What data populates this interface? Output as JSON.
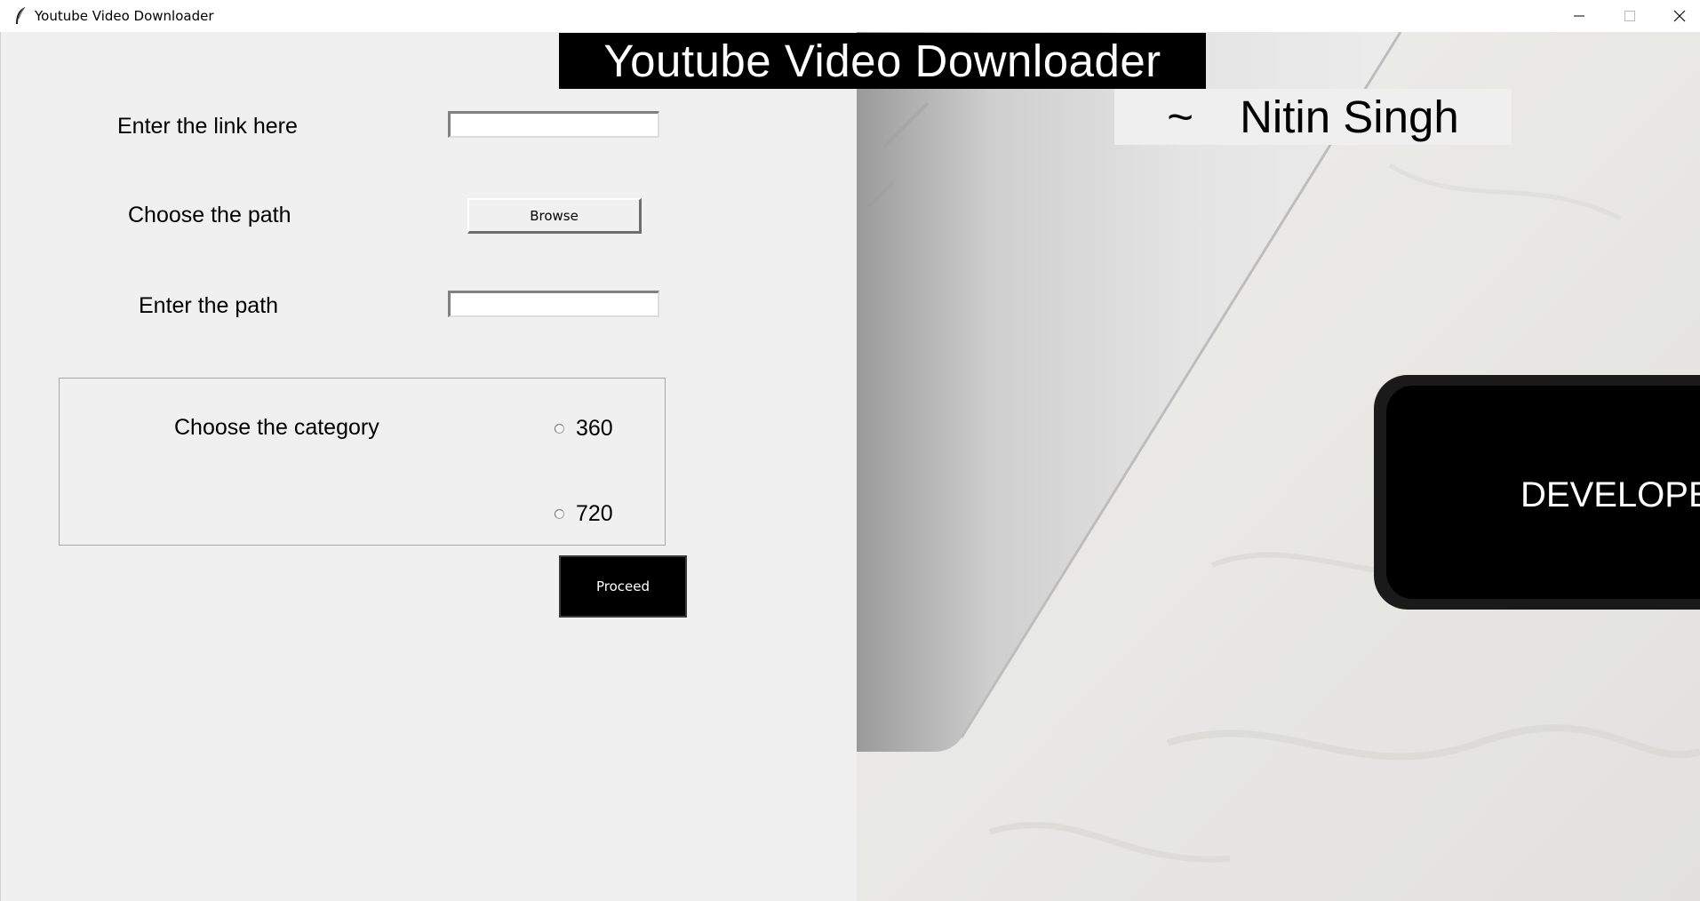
{
  "window": {
    "title": "Youtube Video Downloader",
    "controls": {
      "minimize_icon": "minimize-icon",
      "maximize_icon": "maximize-icon",
      "close_icon": "close-icon"
    }
  },
  "header": {
    "title": "Youtube Video Downloader",
    "author_prefix": "~",
    "author_name": "Nitin Singh"
  },
  "form": {
    "link_label": "Enter the link here",
    "link_value": "",
    "path_label": "Choose the path",
    "browse_label": "Browse",
    "enter_path_label": "Enter the path",
    "path_value": "",
    "category_label": "Choose the category",
    "options": [
      "360",
      "720"
    ],
    "proceed_label": "Proceed"
  },
  "background_photo": {
    "phone_text": "DEVELOPE"
  },
  "colors": {
    "window_bg": "#f0f0f0",
    "banner_bg": "#000000",
    "banner_fg": "#ffffff",
    "proceed_bg": "#000000"
  }
}
